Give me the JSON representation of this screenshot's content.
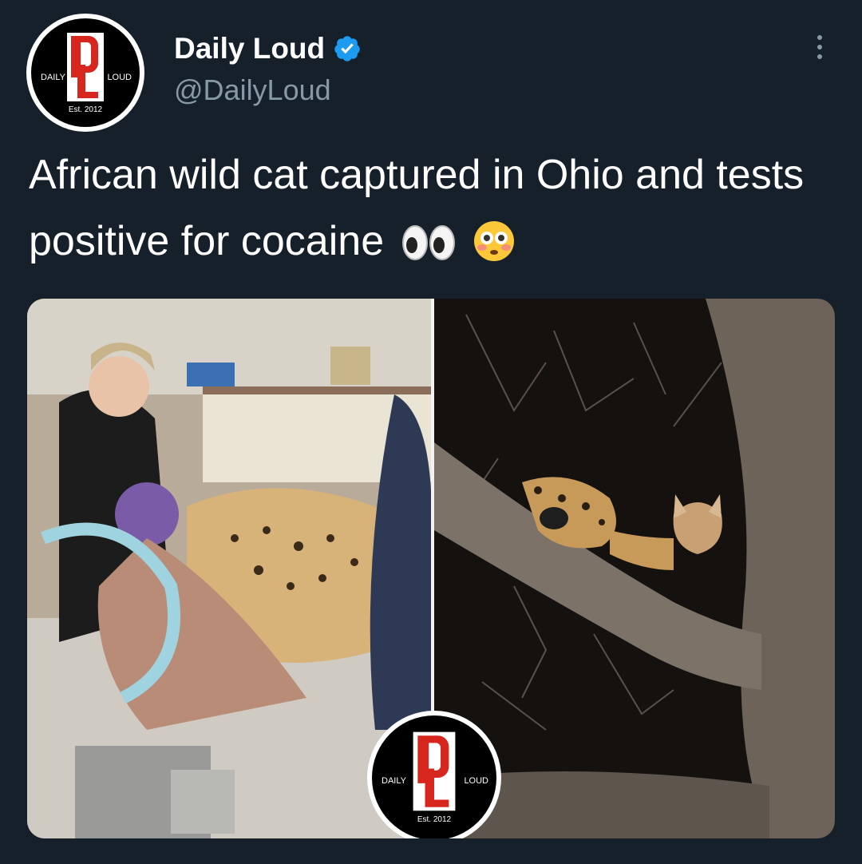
{
  "tweet": {
    "author": {
      "name": "Daily Loud",
      "handle": "@DailyLoud",
      "verified": true,
      "avatar_icon": "daily-loud-logo"
    },
    "text": "African wild cat captured in Ohio and tests positive for cocaine",
    "emojis": [
      "eyes-emoji",
      "flushed-face-emoji"
    ],
    "more_icon": "more-options-icon"
  },
  "logo": {
    "left_word": "DAILY",
    "right_word": "LOUD",
    "established": "Est. 2012"
  },
  "media": {
    "photos": [
      {
        "subject": "serval on veterinary table"
      },
      {
        "subject": "serval in tree at night"
      }
    ]
  },
  "colors": {
    "background": "#15202b",
    "text_primary": "#ffffff",
    "text_secondary": "#8899a6",
    "verified": "#1d9bf0",
    "brand_red": "#d7261e"
  }
}
